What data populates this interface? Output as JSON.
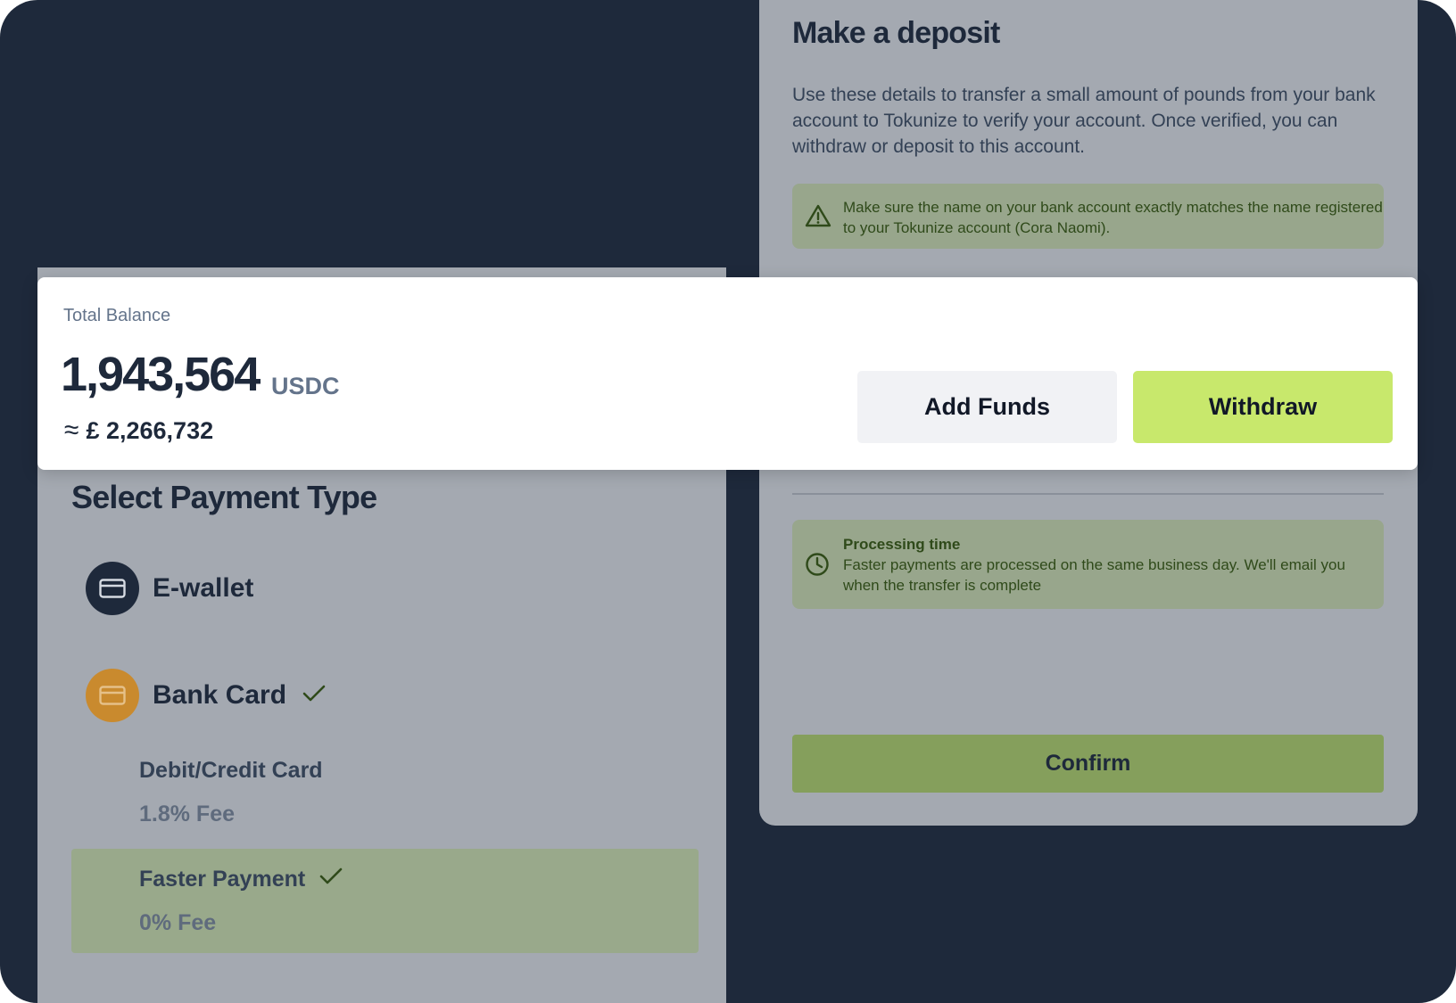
{
  "deposit": {
    "title": "Make a deposit",
    "description": "Use these details to transfer a small amount of pounds from your bank account to Tokunize to verify your account. Once verified, you can withdraw or deposit to this account.",
    "warning": "Make sure the name on your bank account exactly matches the name registered to your Tokunize account (Cora Naomi).",
    "processing_title": "Processing time",
    "processing_text": "Faster payments are processed on the same business day. We'll email you when the transfer is complete",
    "confirm_label": "Confirm"
  },
  "balance": {
    "label": "Total Balance",
    "amount": "1,943,564",
    "unit": "USDC",
    "approx_symbol": "≈",
    "approx_value": "£ 2,266,732",
    "add_funds_label": "Add Funds",
    "withdraw_label": "Withdraw"
  },
  "payment": {
    "title": "Select Payment Type",
    "methods": [
      {
        "label": "E-wallet",
        "icon": "card-icon",
        "color": "#1e293b"
      },
      {
        "label": "Bank Card",
        "icon": "card-icon",
        "color": "#c98a2e",
        "selected": true
      }
    ],
    "options": [
      {
        "label": "Debit/Credit Card",
        "fee": "1.8% Fee"
      },
      {
        "label": "Faster Payment",
        "fee": "0% Fee",
        "selected": true
      }
    ]
  },
  "colors": {
    "background": "#1e293b",
    "panel": "#a4a9b1",
    "accent": "#c8e86c",
    "notice": "#98a68c",
    "confirm": "#859f5c"
  }
}
